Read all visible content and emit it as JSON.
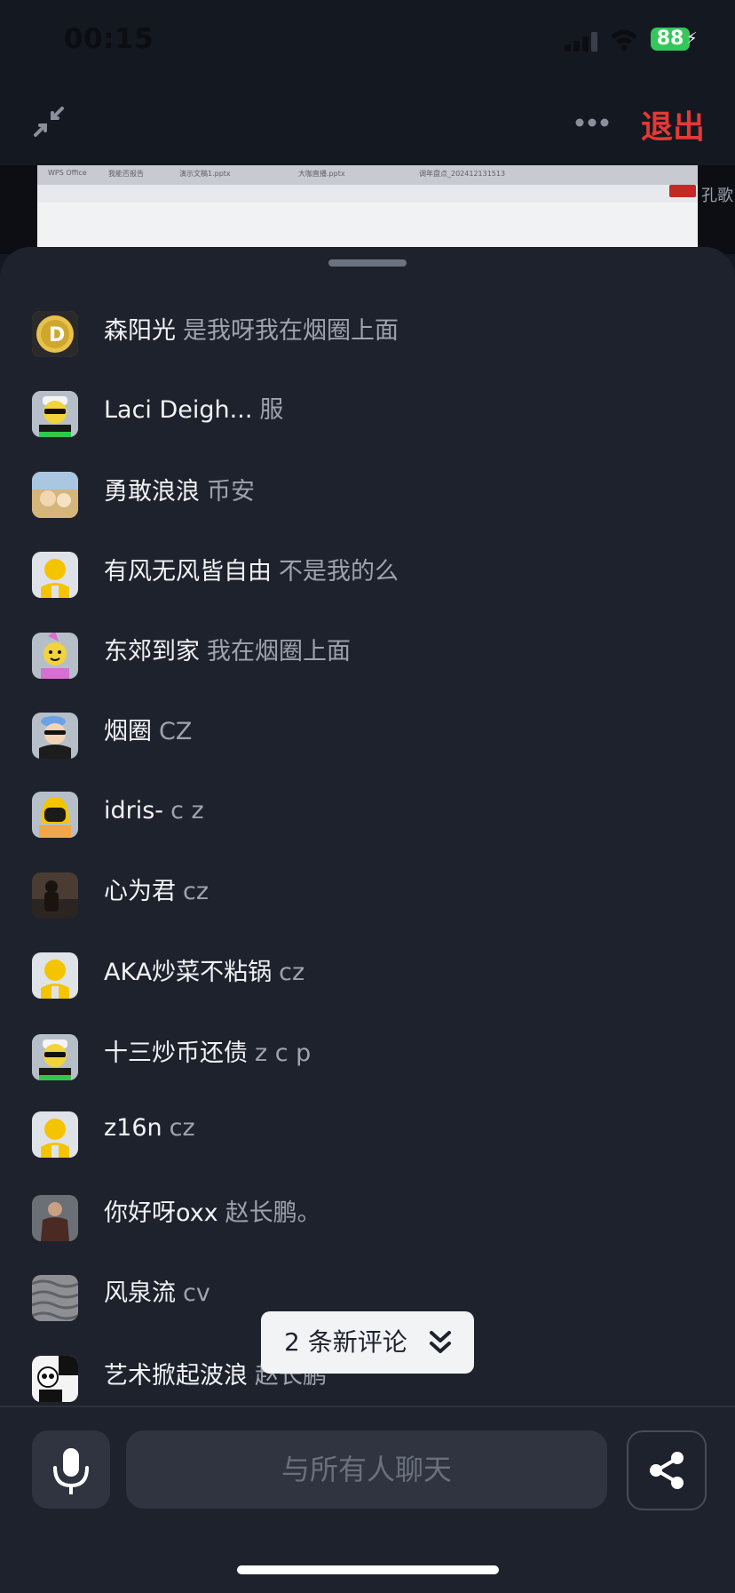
{
  "status": {
    "time": "00:15",
    "battery": "88"
  },
  "top_bar": {
    "exit_label": "退出"
  },
  "screen_share": {
    "tabs": [
      "WPS Office",
      "我能否报告",
      "演示文稿1.pptx",
      "大咖直播.pptx",
      "调年盘点_202412131513"
    ],
    "side_text": "孔歌"
  },
  "messages": [
    {
      "name": "森阳光",
      "text": "是我呀我在烟圈上面",
      "avatar": "doge-coin-avatar"
    },
    {
      "name": "Laci Deigh...",
      "text": "服",
      "avatar": "sunglasses-emoji-avatar"
    },
    {
      "name": "勇敢浪浪",
      "text": "币安",
      "avatar": "photo-avatar"
    },
    {
      "name": "有风无风皆自由",
      "text": "不是我的么",
      "avatar": "default-avatar"
    },
    {
      "name": "东郊到家",
      "text": "我在烟圈上面",
      "avatar": "party-emoji-avatar"
    },
    {
      "name": "烟圈",
      "text": "CZ",
      "avatar": "beret-avatar"
    },
    {
      "name": "idris-",
      "text": "c z",
      "avatar": "helmet-avatar"
    },
    {
      "name": "心为君",
      "text": "cz",
      "avatar": "photo-avatar"
    },
    {
      "name": "AKA炒菜不粘锅",
      "text": "cz",
      "avatar": "default-avatar"
    },
    {
      "name": "十三炒币还债",
      "text": "z c p",
      "avatar": "sunglasses-emoji-avatar"
    },
    {
      "name": "z16n",
      "text": "cz",
      "avatar": "default-avatar"
    },
    {
      "name": "你好呀oxx",
      "text": "赵长鹏。",
      "avatar": "photo-avatar"
    },
    {
      "name": "风泉流",
      "text": "cv",
      "avatar": "texture-avatar"
    },
    {
      "name": "艺术掀起波浪",
      "text": "赵长鹏",
      "avatar": "panda-avatar"
    }
  ],
  "new_comments": {
    "label": "2 条新评论"
  },
  "input": {
    "placeholder": "与所有人聊天"
  },
  "colors": {
    "accent_exit": "#e53935",
    "battery": "#34c759",
    "sheet_bg": "#1e222d"
  }
}
